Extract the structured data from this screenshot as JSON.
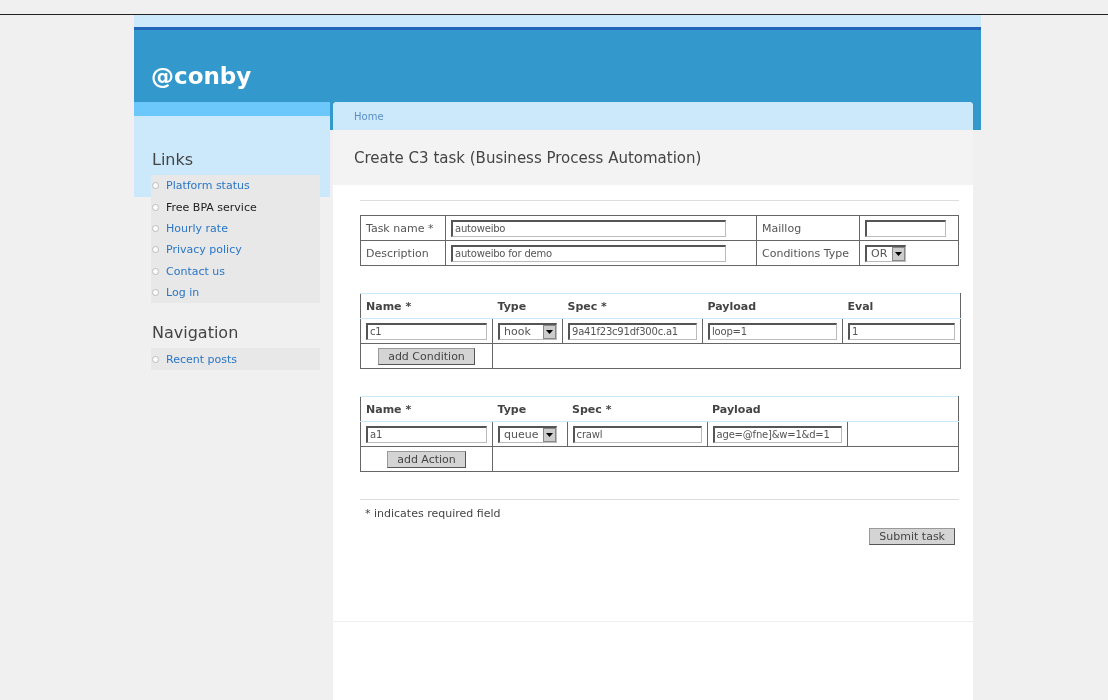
{
  "site": {
    "title": "@conby"
  },
  "sidebar": {
    "sections": [
      {
        "title": "Links",
        "items": [
          {
            "label": "Platform status",
            "selected": false
          },
          {
            "label": "Free BPA service",
            "selected": true
          },
          {
            "label": "Hourly rate",
            "selected": false
          },
          {
            "label": "Privacy policy",
            "selected": false
          },
          {
            "label": "Contact us",
            "selected": false
          },
          {
            "label": "Log in",
            "selected": false
          }
        ]
      },
      {
        "title": "Navigation",
        "items": [
          {
            "label": "Recent posts",
            "selected": false
          }
        ]
      }
    ]
  },
  "breadcrumb": [
    "Home"
  ],
  "page_title": "Create C3 task (Business Process Automation)",
  "task_form": {
    "rows": [
      {
        "label": "Task name *",
        "value": "autoweibo",
        "side_label": "Maillog",
        "kind": "input",
        "side_value": ""
      },
      {
        "label": "Description",
        "value": "autoweibo for demo",
        "side_label": "Conditions Type",
        "kind": "select",
        "side_value": "OR"
      }
    ]
  },
  "conditions": {
    "columns": [
      "Name *",
      "Type",
      "Spec *",
      "Payload",
      "Eval"
    ],
    "row": [
      {
        "kind": "input",
        "value": "c1"
      },
      {
        "kind": "select",
        "value": "hook"
      },
      {
        "kind": "input",
        "value": "9a41f23c91df300c.a1"
      },
      {
        "kind": "input",
        "value": "loop=1"
      },
      {
        "kind": "input",
        "value": "1"
      }
    ],
    "button": "add Condition"
  },
  "actions": {
    "columns": [
      "Name *",
      "Type",
      "Spec *",
      "Payload"
    ],
    "row": [
      {
        "kind": "input",
        "value": "a1"
      },
      {
        "kind": "select",
        "value": "queue"
      },
      {
        "kind": "input",
        "value": "crawl"
      },
      {
        "kind": "input",
        "value": "age=@fne]&w=1&d=1"
      }
    ],
    "button": "add Action"
  },
  "note": "* indicates required field",
  "submit": "Submit task"
}
